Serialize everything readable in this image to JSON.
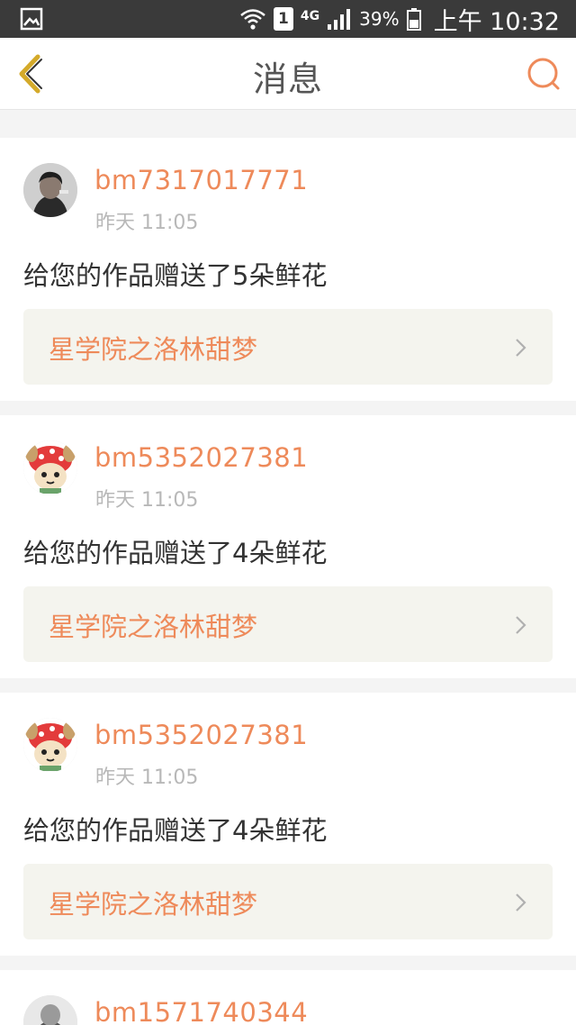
{
  "status_bar": {
    "network": "4G",
    "sim": "1",
    "battery": "39%",
    "time": "上午 10:32"
  },
  "nav": {
    "title": "消息",
    "back_icon": "chevron-left-icon",
    "search_icon": "search-icon"
  },
  "colors": {
    "accent": "#ee8a5a",
    "back_icon": "#d4aa2a",
    "link_bg": "#f4f4ee"
  },
  "messages": [
    {
      "username": "bm7317017771",
      "time": "昨天 11:05",
      "text": "给您的作品赠送了5朵鲜花",
      "work_title": "星学院之洛林甜梦"
    },
    {
      "username": "bm5352027381",
      "time": "昨天 11:05",
      "text": "给您的作品赠送了4朵鲜花",
      "work_title": "星学院之洛林甜梦"
    },
    {
      "username": "bm5352027381",
      "time": "昨天 11:05",
      "text": "给您的作品赠送了4朵鲜花",
      "work_title": "星学院之洛林甜梦"
    },
    {
      "username": "bm1571740344"
    }
  ]
}
